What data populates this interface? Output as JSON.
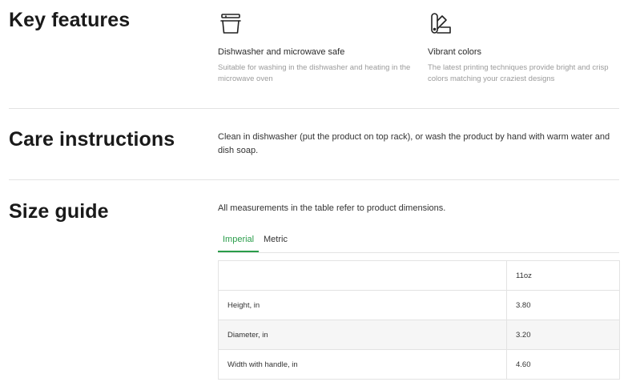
{
  "key_features": {
    "title": "Key features",
    "items": [
      {
        "icon": "dishwasher-icon",
        "title": "Dishwasher and microwave safe",
        "description": "Suitable for washing in the dishwasher and heating in the microwave oven"
      },
      {
        "icon": "color-swatch-icon",
        "title": "Vibrant colors",
        "description": "The latest printing techniques provide bright and crisp colors matching your craziest designs"
      }
    ]
  },
  "care": {
    "title": "Care instructions",
    "text": "Clean in dishwasher (put the product on top rack), or wash the product by hand with warm water and dish soap."
  },
  "size_guide": {
    "title": "Size guide",
    "intro": "All measurements in the table refer to product dimensions.",
    "tabs": [
      {
        "label": "Imperial",
        "active": true
      },
      {
        "label": "Metric",
        "active": false
      }
    ],
    "table": {
      "column_header": "11oz",
      "rows": [
        {
          "label": "Height, in",
          "value": "3.80"
        },
        {
          "label": "Diameter, in",
          "value": "3.20"
        },
        {
          "label": "Width with handle, in",
          "value": "4.60"
        }
      ]
    }
  },
  "colors": {
    "accent": "#2a9d4a",
    "divider": "#e3e3e3",
    "muted_text": "#9b9b9b"
  }
}
